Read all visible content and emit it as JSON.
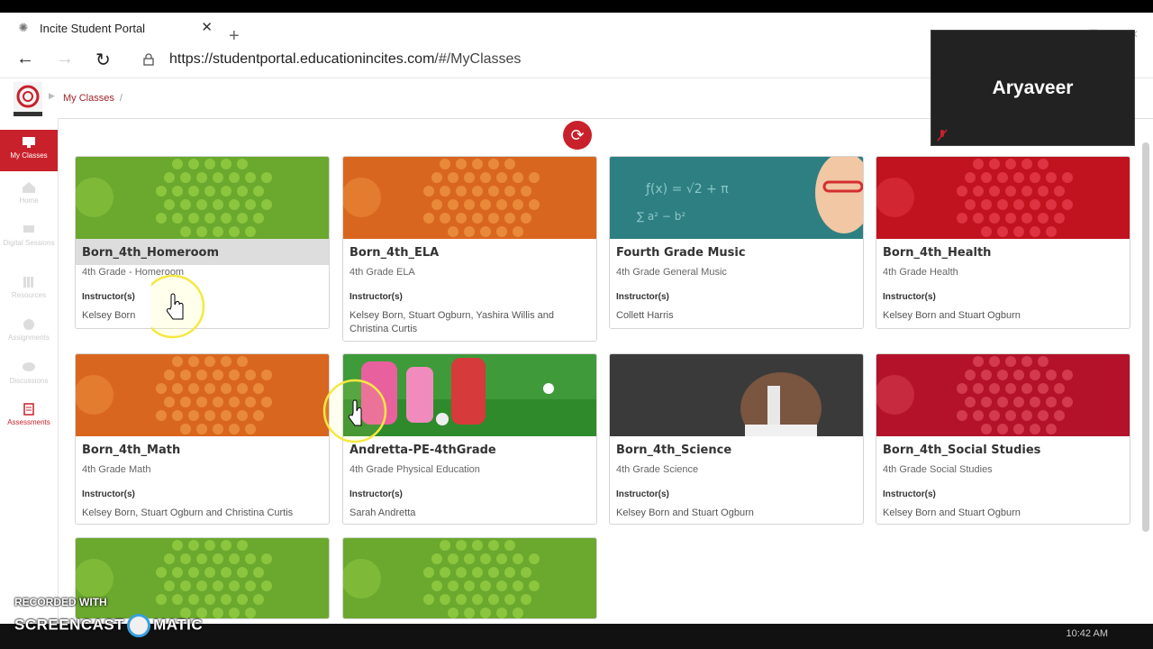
{
  "browser": {
    "tab_title": "Incite Student Portal",
    "url_host": "https://studentportal.educationincites.com",
    "url_path": "/#/MyClasses"
  },
  "app": {
    "breadcrumb": "My Classes",
    "breadcrumb_sep": "/",
    "brand_color": "#c8212b"
  },
  "sidebar": {
    "items": [
      {
        "label": "My Classes",
        "icon": "monitor-icon",
        "active": true
      },
      {
        "label": "Home",
        "icon": "home-icon"
      },
      {
        "label": "Digital Sessions",
        "icon": "sessions-icon"
      },
      {
        "label": "Resources",
        "icon": "resources-icon"
      },
      {
        "label": "Assignments",
        "icon": "assignments-icon"
      },
      {
        "label": "Discussions",
        "icon": "discussions-icon"
      },
      {
        "label": "Assessments",
        "icon": "assessments-icon"
      }
    ]
  },
  "cards": [
    {
      "title": "Born_4th_Homeroom",
      "subtitle": "4th Grade - Homeroom",
      "instructor_label": "Instructor(s)",
      "instructors": "Kelsey Born",
      "theme": "green"
    },
    {
      "title": "Born_4th_ELA",
      "subtitle": "4th Grade ELA",
      "instructor_label": "Instructor(s)",
      "instructors": "Kelsey Born, Stuart Ogburn, Yashira Willis and Christina Curtis",
      "theme": "orange"
    },
    {
      "title": "Fourth Grade Music",
      "subtitle": "4th Grade General Music",
      "instructor_label": "Instructor(s)",
      "instructors": "Collett Harris",
      "theme": "teal"
    },
    {
      "title": "Born_4th_Health",
      "subtitle": "4th Grade Health",
      "instructor_label": "Instructor(s)",
      "instructors": "Kelsey Born and Stuart Ogburn",
      "theme": "red"
    },
    {
      "title": "Born_4th_Math",
      "subtitle": "4th Grade Math",
      "instructor_label": "Instructor(s)",
      "instructors": "Kelsey Born, Stuart Ogburn and Christina Curtis",
      "theme": "orange"
    },
    {
      "title": "Andretta-PE-4thGrade",
      "subtitle": "4th Grade Physical Education",
      "instructor_label": "Instructor(s)",
      "instructors": "Sarah Andretta",
      "theme": "field"
    },
    {
      "title": "Born_4th_Science",
      "subtitle": "4th Grade Science",
      "instructor_label": "Instructor(s)",
      "instructors": "Kelsey Born and Stuart Ogburn",
      "theme": "dark"
    },
    {
      "title": "Born_4th_Social Studies",
      "subtitle": "4th Grade Social Studies",
      "instructor_label": "Instructor(s)",
      "instructors": "Kelsey Born and Stuart Ogburn",
      "theme": "crimson"
    }
  ],
  "partial_cards": [
    {
      "theme": "green"
    },
    {
      "theme": "green"
    }
  ],
  "video_overlay": {
    "name": "Aryaveer"
  },
  "watermark": {
    "line1": "RECORDED WITH",
    "line2_a": "SCREENCAST",
    "line2_b": "MATIC"
  },
  "taskbar": {
    "clock": "10:42 AM"
  }
}
